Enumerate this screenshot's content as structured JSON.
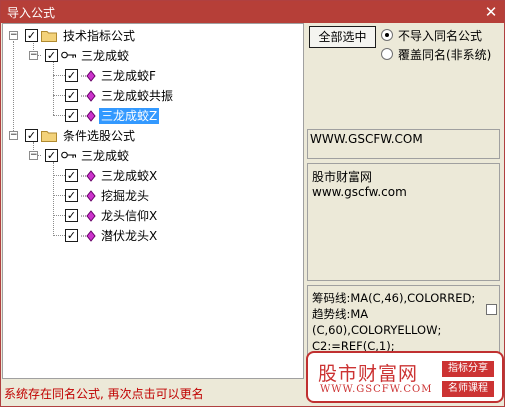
{
  "window": {
    "title": "导入公式",
    "close_glyph": "✕"
  },
  "tree": {
    "groups": [
      {
        "label": "技术指标公式",
        "checked": true,
        "expander": "−",
        "subgroup": {
          "label": "三龙成蛟",
          "checked": true,
          "expander": "−",
          "items": [
            {
              "label": "三龙成蛟F",
              "checked": true,
              "selected": false
            },
            {
              "label": "三龙成蛟共振",
              "checked": true,
              "selected": false
            },
            {
              "label": "三龙成蛟Z",
              "checked": true,
              "selected": true
            }
          ]
        }
      },
      {
        "label": "条件选股公式",
        "checked": true,
        "expander": "−",
        "subgroup": {
          "label": "三龙成蛟",
          "checked": true,
          "expander": "−",
          "items": [
            {
              "label": "三龙成蛟X",
              "checked": true,
              "selected": false
            },
            {
              "label": "挖掘龙头",
              "checked": true,
              "selected": false
            },
            {
              "label": "龙头信仰X",
              "checked": true,
              "selected": false
            },
            {
              "label": "潜伏龙头X",
              "checked": true,
              "selected": false
            }
          ]
        }
      }
    ]
  },
  "check_glyph": "✓",
  "controls": {
    "select_all_label": "全部选中",
    "radio_options": [
      {
        "label": "不导入同名公式",
        "checked": true
      },
      {
        "label": "覆盖同名(非系统)",
        "checked": false
      }
    ]
  },
  "info": {
    "url": "WWW.GSCFW.COM",
    "desc_line1": "股市财富网",
    "desc_line2": "www.gscfw.com",
    "code": "筹码线:MA(C,46),COLORRED;\n趋势线:MA\n(C,60),COLORYELLOW;\nC2:=REF(C,1);"
  },
  "status": {
    "message": "系统存在同名公式, 再次点击可以更名"
  },
  "watermark": {
    "title": "股市财富网",
    "url": "WWW.GSCFW.COM",
    "tag1": "指标分享",
    "tag2": "名师课程"
  },
  "icons": {
    "folder": "folder-icon",
    "key": "key-icon",
    "formula": "formula-icon",
    "close": "close-icon"
  },
  "colors": {
    "titlebar": "#b63f38",
    "selection": "#3399ff",
    "status_text": "#c00000",
    "watermark_red": "#cc3333"
  }
}
